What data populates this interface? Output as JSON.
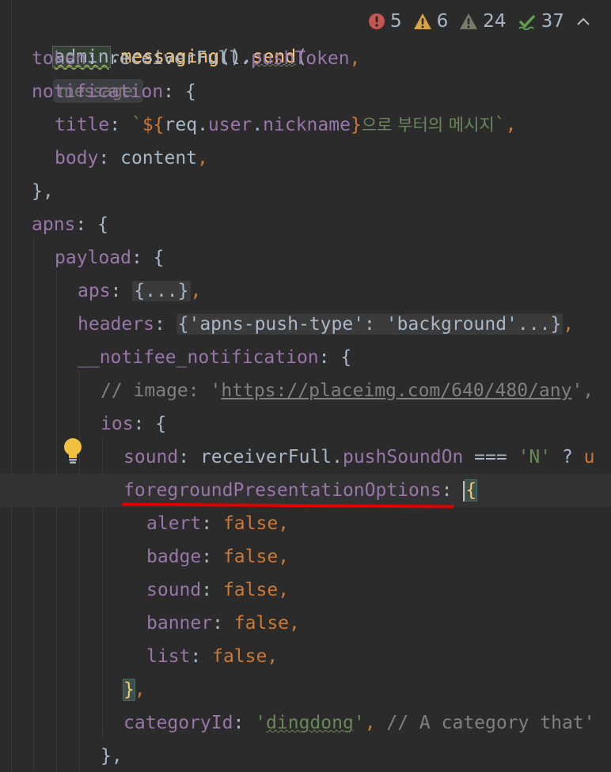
{
  "editor": {
    "line1": {
      "receiver": "admin",
      "dot1": ".",
      "method1": "messaging",
      "call": "().",
      "method2": "send",
      "paren": "(",
      "param_hint": "message:"
    },
    "inspections": [
      {
        "icon": "error-icon",
        "count": "5",
        "color": "#c75450"
      },
      {
        "icon": "warning-icon",
        "count": "6",
        "color": "#d9a343"
      },
      {
        "icon": "weak-warning-icon",
        "count": "24",
        "color": "#7a7a6a"
      },
      {
        "icon": "typo-check-icon",
        "count": "37",
        "color": "#5f9f4f"
      }
    ],
    "lines": {
      "l2_prop": "token",
      "l2_colon": ": ",
      "l2_val1": "receiverFull",
      "l2_dot": ".",
      "l2_val2": "pushToken",
      "l2_comma": ",",
      "l3_prop": "notification",
      "l3_rest": ": {",
      "l4_prop": "title",
      "l4_colon": ": ",
      "l4_tick": "`",
      "l4_open": "${",
      "l4_obj": "req",
      "l4_dot1": ".",
      "l4_user": "user",
      "l4_dot2": ".",
      "l4_nick": "nickname",
      "l4_close": "}",
      "l4_korean": "으로 부터의 메시지",
      "l4_tick2": "`",
      "l4_comma": ",",
      "l5_prop": "body",
      "l5_colon": ": ",
      "l5_val": "content",
      "l5_comma": ",",
      "l6_text": "},",
      "l7_prop": "apns",
      "l7_rest": ": {",
      "l8_prop": "payload",
      "l8_rest": ": {",
      "l9_prop": "aps",
      "l9_colon": ": ",
      "l9_fold": "{...}",
      "l9_comma": ",",
      "l10_prop": "headers",
      "l10_colon": ": ",
      "l10_fold": "{'apns-push-type': 'background'...}",
      "l10_comma": ",",
      "l11_prop": "__notifee_notification",
      "l11_rest": ": {",
      "l12_comment": "// image: '",
      "l12_url": "https://placeimg.com/640/480/any",
      "l12_end": "',",
      "l13_prop": "ios",
      "l13_rest": ": {",
      "l14_prop": "sound",
      "l14_colon": ": ",
      "l14_val1": "receiverFull",
      "l14_dot": ".",
      "l14_val2": "pushSoundOn",
      "l14_op": " === ",
      "l14_str": "'N'",
      "l14_q": " ? ",
      "l14_cut": "u",
      "l15_prop": "foregroundPresentationOptions",
      "l15_colon": ": ",
      "l15_brace": "{",
      "l16_prop": "alert",
      "l16_colon": ": ",
      "l16_val": "false",
      "l16_comma": ",",
      "l17_prop": "badge",
      "l17_colon": ": ",
      "l17_val": "false",
      "l17_comma": ",",
      "l18_prop": "sound",
      "l18_colon": ": ",
      "l18_val": "false",
      "l18_comma": ",",
      "l19_prop": "banner",
      "l19_colon": ": ",
      "l19_val": "false",
      "l19_comma": ",",
      "l20_prop": "list",
      "l20_colon": ": ",
      "l20_val": "false",
      "l20_comma": ",",
      "l21_brace": "}",
      "l21_comma": ",",
      "l22_prop": "categoryId",
      "l22_colon": ": ",
      "l22_q1": "'",
      "l22_val": "dingdong",
      "l22_q2": "'",
      "l22_comma": ", ",
      "l22_comment": "// A category that'",
      "l23_text": "},"
    }
  },
  "colors": {
    "background": "#2b2b2b",
    "property": "#9876aa",
    "function": "#ffc66d",
    "keyword": "#cc7832",
    "string": "#6a8759",
    "comment": "#808080",
    "highlight_underline": "#e00000"
  }
}
